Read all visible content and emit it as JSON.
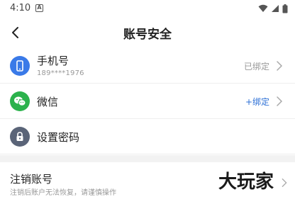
{
  "status_bar": {
    "time": "4:10",
    "notification_letter": "A"
  },
  "header": {
    "title": "账号安全"
  },
  "rows": [
    {
      "label": "手机号",
      "sublabel": "189****1976",
      "right_text": "已绑定",
      "icon": "phone-icon",
      "icon_color": "#3a7ae8"
    },
    {
      "label": "微信",
      "right_text": "+绑定",
      "icon": "wechat-icon",
      "icon_color": "#2bb24c"
    },
    {
      "label": "设置密码",
      "icon": "lock-icon",
      "icon_color": "#5a6478"
    }
  ],
  "cancel_account": {
    "title": "注销账号",
    "description": "注销后账户无法恢复，请谨慎操作"
  },
  "watermark": {
    "text": "大玩家"
  },
  "colors": {
    "link": "#2b6fd6",
    "muted": "#999999",
    "divider": "#f2f2f2"
  }
}
